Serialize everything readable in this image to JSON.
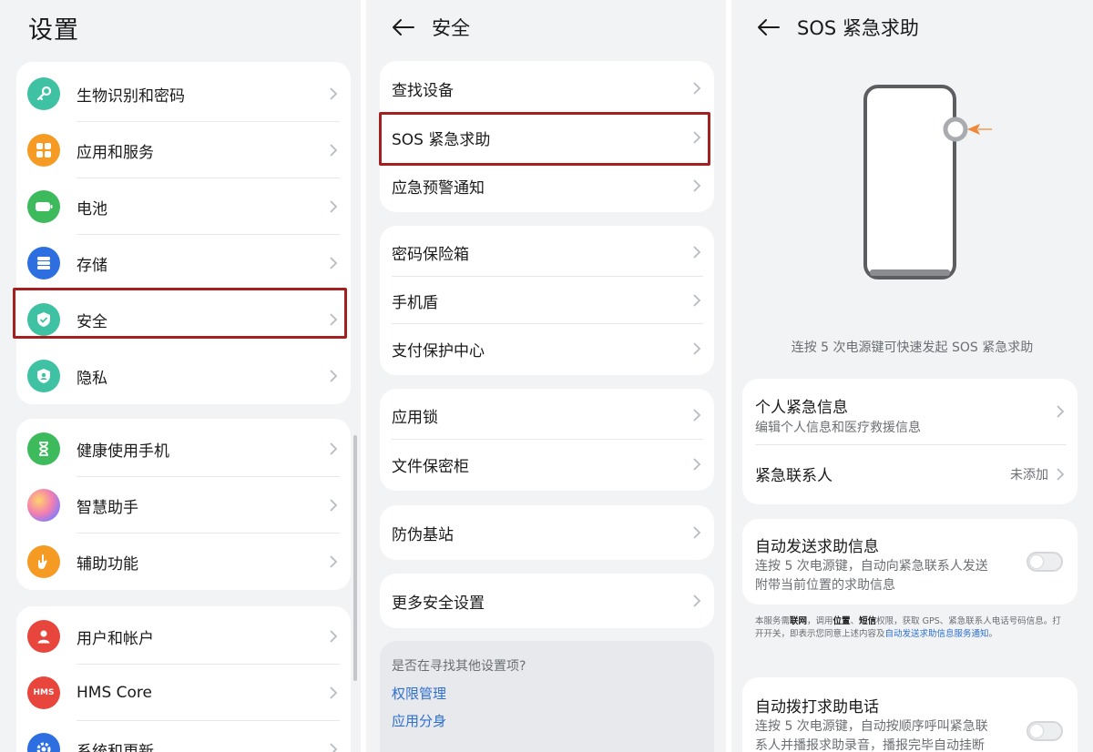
{
  "settings": {
    "title": "设置",
    "groups": [
      {
        "items": [
          {
            "label": "生物识别和密码",
            "icon": "key-icon",
            "color": "#3fc1a4"
          },
          {
            "label": "应用和服务",
            "icon": "apps-grid-icon",
            "color": "#f59a23"
          },
          {
            "label": "电池",
            "icon": "battery-icon",
            "color": "#3dbb5c"
          },
          {
            "label": "存储",
            "icon": "storage-icon",
            "color": "#2d6fe0"
          },
          {
            "label": "安全",
            "icon": "shield-check-icon",
            "color": "#3fc1a4"
          },
          {
            "label": "隐私",
            "icon": "privacy-shield-icon",
            "color": "#3fc1a4"
          }
        ]
      },
      {
        "items": [
          {
            "label": "健康使用手机",
            "icon": "hourglass-icon",
            "color": "#3dbb5c"
          },
          {
            "label": "智慧助手",
            "icon": "assistant-orb-icon",
            "color": "#b18cf0"
          },
          {
            "label": "辅助功能",
            "icon": "hand-icon",
            "color": "#f59a23"
          }
        ]
      },
      {
        "items": [
          {
            "label": "用户和帐户",
            "icon": "user-icon",
            "color": "#e8453c"
          },
          {
            "label": "HMS Core",
            "icon": "hms-core-icon",
            "color": "#e8453c",
            "icon_text": "HMS"
          },
          {
            "label": "系统和更新",
            "icon": "gear-icon",
            "color": "#2d6fe0"
          }
        ]
      }
    ]
  },
  "security": {
    "title": "安全",
    "groups": [
      [
        "查找设备",
        "SOS 紧急求助",
        "应急预警通知"
      ],
      [
        "密码保险箱",
        "手机盾",
        "支付保护中心"
      ],
      [
        "应用锁",
        "文件保密柜"
      ],
      [
        "防伪基站"
      ],
      [
        "更多安全设置"
      ]
    ],
    "more_prompt": "是否在寻找其他设置项?",
    "links": [
      "权限管理",
      "应用分身"
    ]
  },
  "sos": {
    "title": "SOS 紧急求助",
    "illustration_caption": "连按 5 次电源键可快速发起 SOS 紧急求助",
    "personal_info": {
      "title": "个人紧急信息",
      "subtitle": "编辑个人信息和医疗救援信息"
    },
    "contacts": {
      "title": "紧急联系人",
      "value": "未添加"
    },
    "auto_send": {
      "title": "自动发送求助信息",
      "desc_line1": "连按 5 次电源键，自动向紧急联系人发送",
      "desc_line2": "附带当前位置的求助信息",
      "enabled": false
    },
    "notice": {
      "p1": "本服务需",
      "b1": "联网",
      "p2": "，调用",
      "b2": "位置",
      "p3": "、",
      "b3": "短信",
      "p4": "权限，获取 GPS、紧急联系人电话号码信息。打开开关，即表示您同意上述内容及",
      "link": "自动发送求助信息服务通知",
      "p5": "。"
    },
    "auto_call": {
      "title": "自动拨打求助电话",
      "desc_line1": "连按 5 次电源键，自动按顺序呼叫紧急联",
      "desc_line2": "系人并播报求助录音，播报完毕自动挂断",
      "enabled": false
    }
  },
  "colors": {
    "highlight": "#a32020",
    "link": "#2f6fd2",
    "accent_arrow": "#f0883a"
  }
}
